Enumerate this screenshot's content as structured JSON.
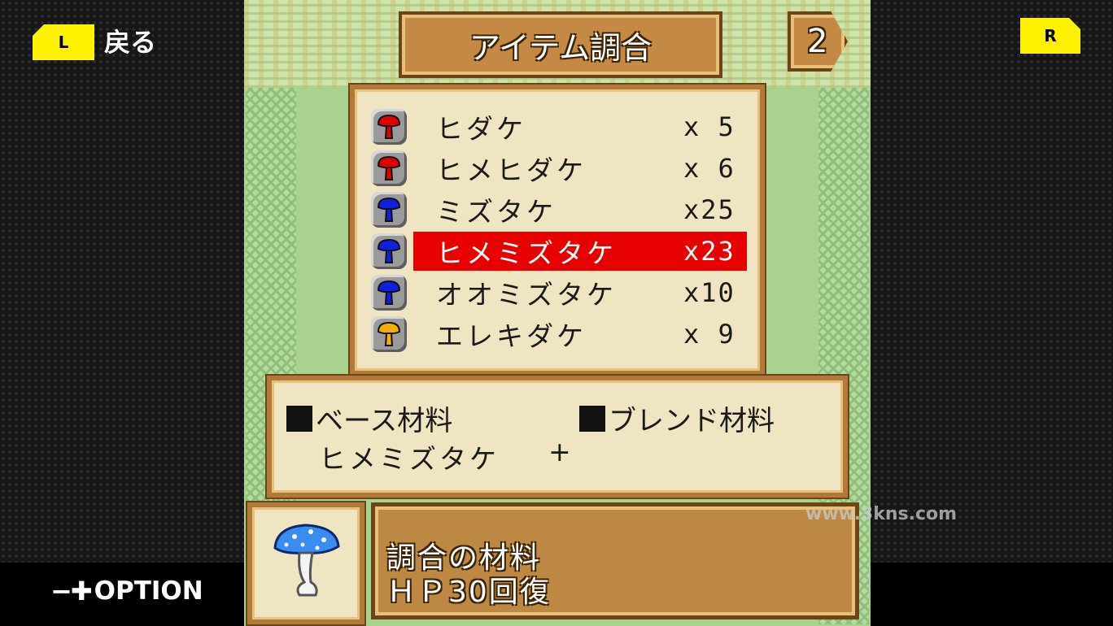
{
  "overlay": {
    "l_button": "L",
    "back_label": "戻る",
    "r_button": "R",
    "option_symbols": "−✚",
    "option_label": "OPTION",
    "watermark": "www.3kns.com"
  },
  "screen": {
    "title": "アイテム調合",
    "page_number": "2"
  },
  "items": [
    {
      "name": "ヒダケ",
      "qty": "x 5",
      "color": "#e00000",
      "icon": "red-mushroom-icon"
    },
    {
      "name": "ヒメヒダケ",
      "qty": "x 6",
      "color": "#e00000",
      "icon": "red-mushroom-icon"
    },
    {
      "name": "ミズタケ",
      "qty": "x25",
      "color": "#1020e0",
      "icon": "blue-mushroom-icon"
    },
    {
      "name": "ヒメミズタケ",
      "qty": "x23",
      "color": "#1020e0",
      "icon": "blue-mushroom-icon",
      "selected": true
    },
    {
      "name": "オオミズタケ",
      "qty": "x10",
      "color": "#1020e0",
      "icon": "blue-mushroom-icon"
    },
    {
      "name": "エレキダケ",
      "qty": "x 9",
      "color": "#f0b000",
      "icon": "yellow-mushroom-icon"
    }
  ],
  "mix": {
    "base_label": "ベース材料",
    "blend_label": "ブレンド材料",
    "base_value": "ヒメミズタケ",
    "plus": "+"
  },
  "description": {
    "line1": "調合の材料",
    "line2": "ＨＰ30回復"
  }
}
